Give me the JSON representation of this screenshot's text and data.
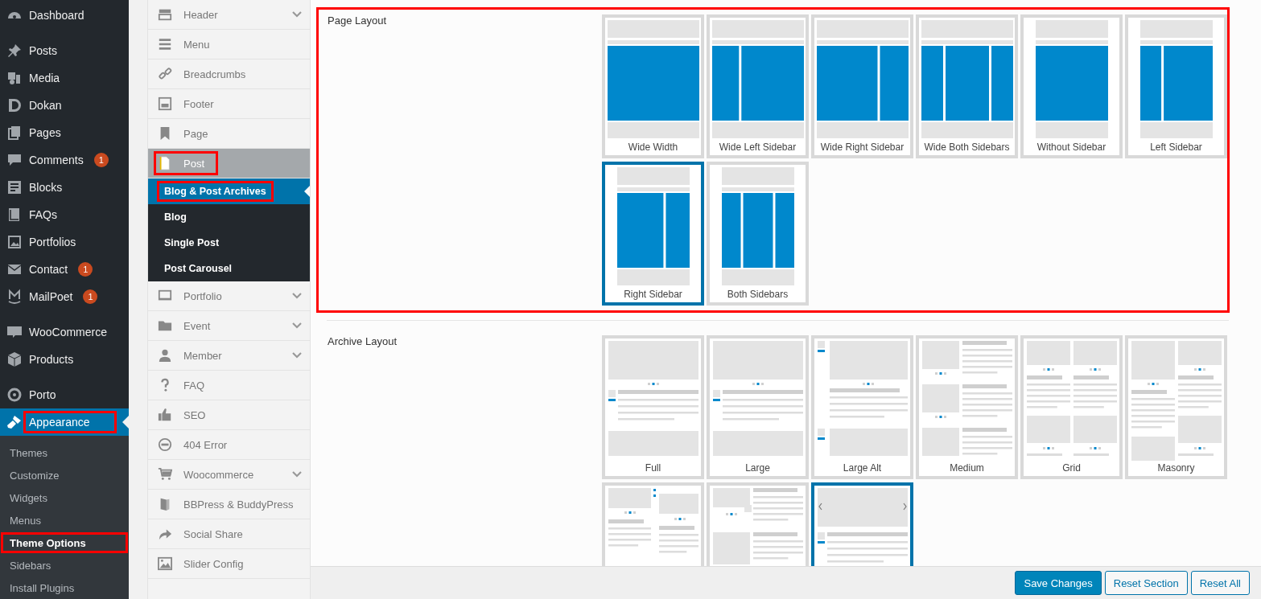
{
  "admin_menu": {
    "groups": [
      {
        "items": [
          {
            "label": "Dashboard",
            "selected": false,
            "highlighted": false
          }
        ]
      },
      {
        "items": [
          {
            "label": "Posts",
            "selected": false,
            "highlighted": false
          },
          {
            "label": "Media",
            "selected": false,
            "highlighted": false
          },
          {
            "label": "Dokan",
            "selected": false,
            "highlighted": false
          },
          {
            "label": "Pages",
            "selected": false,
            "highlighted": false
          },
          {
            "label": "Comments",
            "badge": "1",
            "selected": false,
            "highlighted": false
          },
          {
            "label": "Blocks",
            "selected": false,
            "highlighted": false
          },
          {
            "label": "FAQs",
            "selected": false,
            "highlighted": false
          },
          {
            "label": "Portfolios",
            "selected": false,
            "highlighted": false
          },
          {
            "label": "Contact",
            "badge": "1",
            "selected": false,
            "highlighted": false
          },
          {
            "label": "MailPoet",
            "badge": "1",
            "selected": false,
            "highlighted": false
          }
        ]
      },
      {
        "items": [
          {
            "label": "WooCommerce",
            "selected": false,
            "highlighted": false
          },
          {
            "label": "Products",
            "selected": false,
            "highlighted": false
          }
        ]
      },
      {
        "items": [
          {
            "label": "Porto",
            "selected": false,
            "highlighted": false
          },
          {
            "label": "Appearance",
            "selected": true,
            "highlighted": true,
            "submenu": [
              {
                "label": "Themes",
                "selected": false,
                "highlighted": false
              },
              {
                "label": "Customize",
                "selected": false,
                "highlighted": false
              },
              {
                "label": "Widgets",
                "selected": false,
                "highlighted": false
              },
              {
                "label": "Menus",
                "selected": false,
                "highlighted": false
              },
              {
                "label": "Theme Options",
                "selected": true,
                "highlighted": true
              },
              {
                "label": "Sidebars",
                "selected": false,
                "highlighted": false
              },
              {
                "label": "Install Plugins",
                "selected": false,
                "highlighted": false
              }
            ]
          }
        ]
      }
    ]
  },
  "options_panel": {
    "items": [
      {
        "label": "Header",
        "expandable": true,
        "selected": false,
        "highlighted": false
      },
      {
        "label": "Menu",
        "expandable": false,
        "selected": false,
        "highlighted": false
      },
      {
        "label": "Breadcrumbs",
        "expandable": false,
        "selected": false,
        "highlighted": false
      },
      {
        "label": "Footer",
        "expandable": false,
        "selected": false,
        "highlighted": false
      },
      {
        "label": "Page",
        "expandable": false,
        "selected": false,
        "highlighted": false
      },
      {
        "label": "Post",
        "expandable": false,
        "selected": true,
        "highlighted": true,
        "children": [
          {
            "label": "Blog & Post Archives",
            "selected": true,
            "highlighted": true
          },
          {
            "label": "Blog",
            "selected": false,
            "highlighted": false
          },
          {
            "label": "Single Post",
            "selected": false,
            "highlighted": false
          },
          {
            "label": "Post Carousel",
            "selected": false,
            "highlighted": false
          }
        ]
      },
      {
        "label": "Portfolio",
        "expandable": true,
        "selected": false,
        "highlighted": false
      },
      {
        "label": "Event",
        "expandable": true,
        "selected": false,
        "highlighted": false
      },
      {
        "label": "Member",
        "expandable": true,
        "selected": false,
        "highlighted": false
      },
      {
        "label": "FAQ",
        "expandable": false,
        "selected": false,
        "highlighted": false
      },
      {
        "label": "SEO",
        "expandable": false,
        "selected": false,
        "highlighted": false
      },
      {
        "label": "404 Error",
        "expandable": false,
        "selected": false,
        "highlighted": false
      },
      {
        "label": "Woocommerce",
        "expandable": true,
        "selected": false,
        "highlighted": false
      },
      {
        "label": "BBPress & BuddyPress",
        "expandable": false,
        "selected": false,
        "highlighted": false
      },
      {
        "label": "Social Share",
        "expandable": false,
        "selected": false,
        "highlighted": false
      },
      {
        "label": "Slider Config",
        "expandable": false,
        "selected": false,
        "highlighted": false
      }
    ]
  },
  "sections": [
    {
      "title": "Page Layout",
      "highlighted": true,
      "options": [
        {
          "label": "Wide Width",
          "kind": "wide-width",
          "selected": false
        },
        {
          "label": "Wide Left Sidebar",
          "kind": "wide-left",
          "selected": false
        },
        {
          "label": "Wide Right Sidebar",
          "kind": "wide-right",
          "selected": false
        },
        {
          "label": "Wide Both Sidebars",
          "kind": "wide-both",
          "selected": false
        },
        {
          "label": "Without Sidebar",
          "kind": "without",
          "selected": false
        },
        {
          "label": "Left Sidebar",
          "kind": "left",
          "selected": false
        },
        {
          "label": "Right Sidebar",
          "kind": "right",
          "selected": true
        },
        {
          "label": "Both Sidebars",
          "kind": "both",
          "selected": false
        }
      ]
    },
    {
      "title": "Archive Layout",
      "highlighted": false,
      "options": [
        {
          "label": "Full",
          "kind": "full",
          "selected": false
        },
        {
          "label": "Large",
          "kind": "large",
          "selected": false
        },
        {
          "label": "Large Alt",
          "kind": "large-alt",
          "selected": false
        },
        {
          "label": "Medium",
          "kind": "medium",
          "selected": false
        },
        {
          "label": "Grid",
          "kind": "grid",
          "selected": false
        },
        {
          "label": "Masonry",
          "kind": "masonry",
          "selected": false
        },
        {
          "kind": "timeline",
          "selected": false
        },
        {
          "kind": "medium-alt",
          "selected": false
        },
        {
          "kind": "slider",
          "selected": true
        }
      ]
    }
  ],
  "buttons": [
    {
      "label": "Save Changes",
      "kind": "primary"
    },
    {
      "label": "Reset Section",
      "kind": "secondary"
    },
    {
      "label": "Reset All",
      "kind": "secondary"
    }
  ]
}
